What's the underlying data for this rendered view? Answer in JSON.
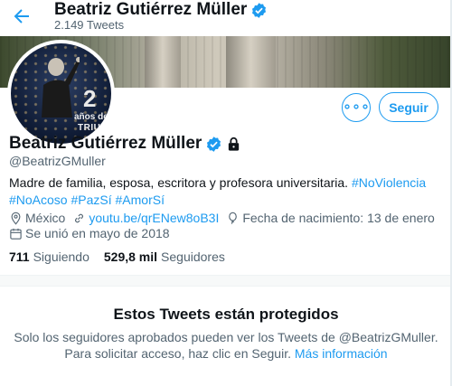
{
  "header": {
    "name": "Beatriz Gutiérrez Müller",
    "tweet_count": "2.149 Tweets"
  },
  "avatar": {
    "number": "2",
    "line1": "años de",
    "line2": "TRIUNF"
  },
  "actions": {
    "more_label": "∘∘∘",
    "follow_label": "Seguir"
  },
  "profile": {
    "name": "Beatriz Gutiérrez Müller",
    "handle": "@BeatrizGMuller",
    "bio_text": "Madre de familia, esposa, escritora y profesora universitaria.",
    "bio_tags_line1": "#NoViolencia",
    "bio_tags_line2": "#NoAcoso #PazSí #AmorSí",
    "location": "México",
    "url": "youtu.be/qrENew8oB3I",
    "birthday": "Fecha de nacimiento: 13 de enero",
    "joined": "Se unió en mayo de 2018",
    "following_count": "711",
    "following_label": "Siguiendo",
    "followers_count": "529,8 mil",
    "followers_label": "Seguidores"
  },
  "protected": {
    "title": "Estos Tweets están protegidos",
    "text": "Solo los seguidores aprobados pueden ver los Tweets de @BeatrizGMuller. Para solicitar acceso, haz clic en Seguir.",
    "link": "Más información"
  },
  "colors": {
    "accent": "#1d9bf0",
    "text": "#0f1419",
    "secondary": "#536471"
  }
}
